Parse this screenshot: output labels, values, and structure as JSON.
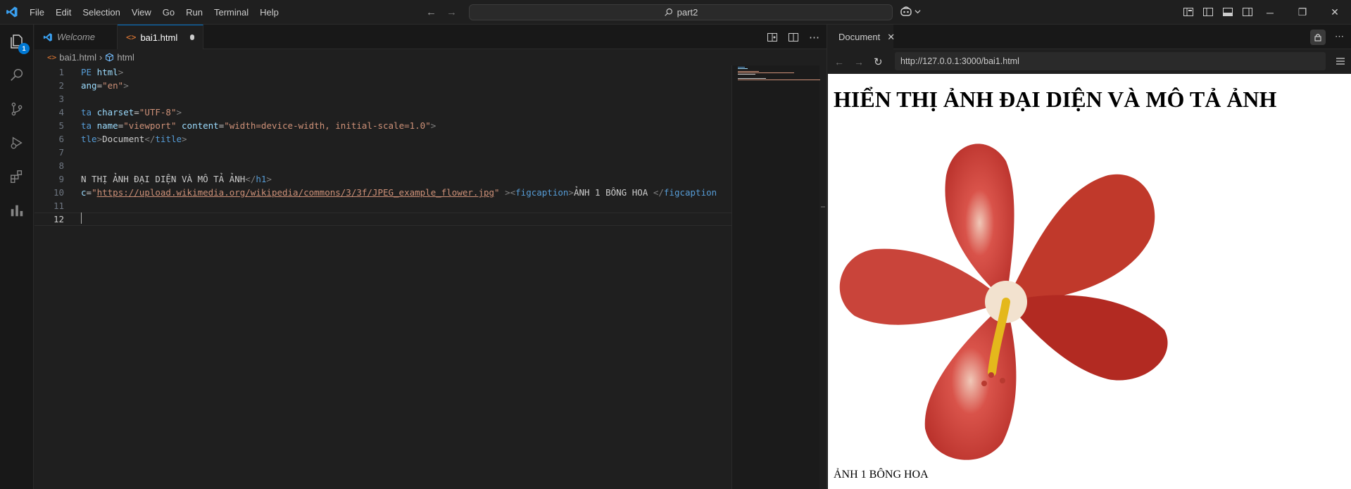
{
  "menu": [
    "File",
    "Edit",
    "Selection",
    "View",
    "Go",
    "Run",
    "Terminal",
    "Help"
  ],
  "search": {
    "text": "part2"
  },
  "activity": {
    "explorer_badge": "1"
  },
  "editor": {
    "tabs": [
      {
        "label": "Welcome"
      },
      {
        "label": "bai1.html"
      }
    ],
    "breadcrumb": {
      "file": "bai1.html",
      "symbol": "html"
    },
    "lines": [
      {
        "n": "1",
        "parts": [
          [
            "#569cd6",
            "PE "
          ],
          [
            "#9cdcfe",
            "html"
          ],
          [
            "#808080",
            ">"
          ]
        ]
      },
      {
        "n": "2",
        "parts": [
          [
            "#9cdcfe",
            "ang"
          ],
          [
            "#cccccc",
            "="
          ],
          [
            "#ce9178",
            "\"en\""
          ],
          [
            "#808080",
            ">"
          ]
        ]
      },
      {
        "n": "3",
        "parts": []
      },
      {
        "n": "4",
        "parts": [
          [
            "#569cd6",
            "ta "
          ],
          [
            "#9cdcfe",
            "charset"
          ],
          [
            "#cccccc",
            "="
          ],
          [
            "#ce9178",
            "\"UTF-8\""
          ],
          [
            "#808080",
            ">"
          ]
        ]
      },
      {
        "n": "5",
        "parts": [
          [
            "#569cd6",
            "ta "
          ],
          [
            "#9cdcfe",
            "name"
          ],
          [
            "#cccccc",
            "="
          ],
          [
            "#ce9178",
            "\"viewport\" "
          ],
          [
            "#9cdcfe",
            "content"
          ],
          [
            "#cccccc",
            "="
          ],
          [
            "#ce9178",
            "\"width=device-width, initial-scale=1.0\""
          ],
          [
            "#808080",
            ">"
          ]
        ]
      },
      {
        "n": "6",
        "parts": [
          [
            "#569cd6",
            "tle"
          ],
          [
            "#808080",
            ">"
          ],
          [
            "#cccccc",
            "Document"
          ],
          [
            "#808080",
            "</"
          ],
          [
            "#569cd6",
            "title"
          ],
          [
            "#808080",
            ">"
          ]
        ]
      },
      {
        "n": "7",
        "parts": []
      },
      {
        "n": "8",
        "parts": []
      },
      {
        "n": "9",
        "parts": [
          [
            "#cccccc",
            "N THỊ ẢNH ĐẠI DIỆN VÀ MÔ TẢ ẢNH"
          ],
          [
            "#808080",
            "</"
          ],
          [
            "#569cd6",
            "h1"
          ],
          [
            "#808080",
            ">"
          ]
        ]
      },
      {
        "n": "10",
        "parts": [
          [
            "#9cdcfe",
            "c"
          ],
          [
            "#cccccc",
            "="
          ],
          [
            "#ce9178",
            "\""
          ],
          [
            "#ce9178u",
            "https://upload.wikimedia.org/wikipedia/commons/3/3f/JPEG_example_flower.jpg"
          ],
          [
            "#ce9178",
            "\" "
          ],
          [
            "#808080",
            "><"
          ],
          [
            "#569cd6",
            "figcaption"
          ],
          [
            "#808080",
            ">"
          ],
          [
            "#cccccc",
            "ẢNH 1 BÔNG HOA "
          ],
          [
            "#808080",
            "</"
          ],
          [
            "#569cd6",
            "figcaption"
          ]
        ]
      },
      {
        "n": "11",
        "parts": []
      },
      {
        "n": "12",
        "parts": []
      }
    ]
  },
  "browser": {
    "tab_label": "Document",
    "url": "http://127.0.0.1:3000/bai1.html",
    "heading": "HIỂN THỊ ẢNH ĐẠI DIỆN VÀ MÔ TẢ ẢNH",
    "caption": "ẢNH 1 BÔNG HOA"
  }
}
